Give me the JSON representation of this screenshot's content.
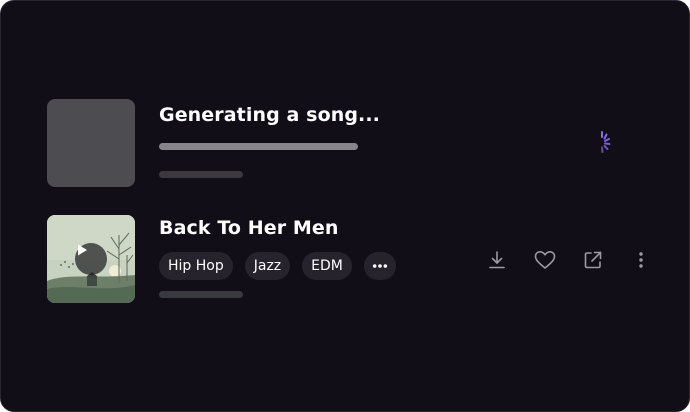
{
  "generating_item": {
    "title": "Generating a song...",
    "spinner_icon": "loading-spinner-icon",
    "spinner_color": "#8b6cf0"
  },
  "song_item": {
    "title": "Back To Her Men",
    "tags": [
      "Hip Hop",
      "Jazz",
      "EDM"
    ],
    "more_tags_label": "•••",
    "actions": [
      {
        "icon": "download-icon"
      },
      {
        "icon": "heart-icon"
      },
      {
        "icon": "share-external-icon"
      },
      {
        "icon": "more-vertical-icon"
      }
    ]
  },
  "colors": {
    "background": "#110e17",
    "tag_background": "#26232c",
    "icon": "#9c9aa1"
  }
}
